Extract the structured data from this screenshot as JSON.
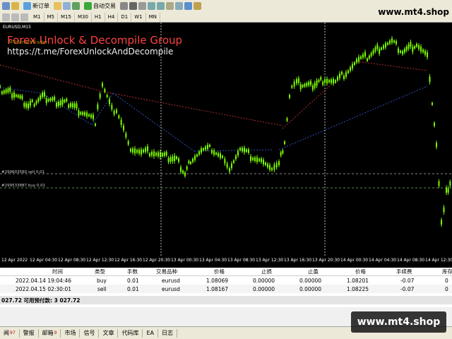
{
  "toolbar": {
    "new_order": "新订单",
    "autotrade": "自动交易",
    "timeframes": [
      "M1",
      "M5",
      "M15",
      "M30",
      "H1",
      "H4",
      "D1",
      "W1",
      "MN"
    ]
  },
  "watermark_top": "www.mt4.shop",
  "chart": {
    "symbol": "EURUSD,M15",
    "overlay_line1": "Forex Unlock & Decompile Group",
    "overlay_line2": "https://t.me/ForexUnlockAndDecompile",
    "indicator_label": "MTrSmartTrader",
    "order_sell_label": "#299603580 sell 0.01",
    "order_buy_label": "#299533887 buy 0.01",
    "x_labels": [
      "12 Apr 2022",
      "12 Apr 04:30",
      "12 Apr 08:30",
      "12 Apr 12:30",
      "12 Apr 16:30",
      "12 Apr 20:30",
      "13 Apr 00:30",
      "13 Apr 04:30",
      "13 Apr 08:30",
      "13 Apr 12:30",
      "13 Apr 16:30",
      "13 Apr 20:30",
      "14 Apr 00:30",
      "14 Apr 04:30",
      "14 Apr 08:30",
      "14 Apr 12:30"
    ],
    "colors": {
      "candle": "#7cfc00",
      "grid": "#404040",
      "bg": "#000000",
      "red_dotted": "#b03030",
      "blue_dotted": "#3050c0",
      "overlay": "#ff4040"
    }
  },
  "grid": {
    "headers": [
      "时间",
      "类型",
      "手数",
      "交易品种",
      "价格",
      "止损",
      "止盈",
      "价格",
      "手续费",
      "库存"
    ],
    "rows": [
      [
        "2022.04.14 19:04:46",
        "buy",
        "0.01",
        "eurusd",
        "1.08069",
        "0.00000",
        "0.00000",
        "1.08201",
        "-0.07",
        "0"
      ],
      [
        "2022.04.15 02:30:01",
        "sell",
        "0.01",
        "eurusd",
        "1.08167",
        "0.00000",
        "0.00000",
        "1.08225",
        "-0.07",
        "0"
      ]
    ],
    "balance_line": "027.72  可用预付款: 3 027.72"
  },
  "tabs": [
    {
      "label": "闻",
      "badge": "97"
    },
    {
      "label": "警报",
      "badge": ""
    },
    {
      "label": "邮箱",
      "badge": "9"
    },
    {
      "label": "市场",
      "badge": ""
    },
    {
      "label": "信号",
      "badge": ""
    },
    {
      "label": "文章",
      "badge": ""
    },
    {
      "label": "代码库",
      "badge": ""
    },
    {
      "label": "EA",
      "badge": ""
    },
    {
      "label": "日志",
      "badge": ""
    }
  ],
  "watermark": "www.mt4.shop"
}
